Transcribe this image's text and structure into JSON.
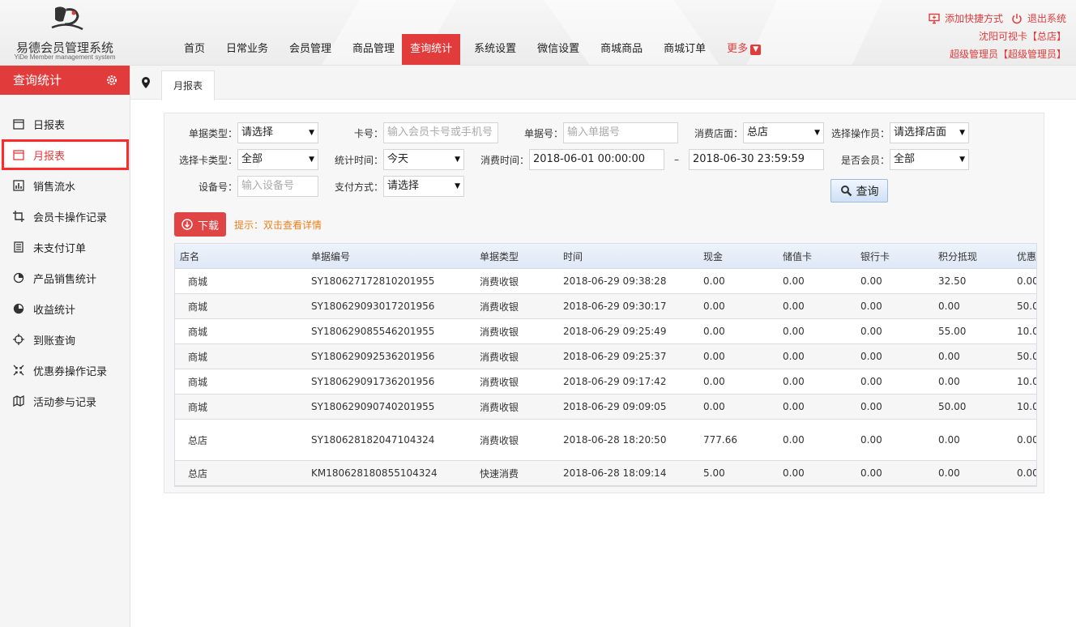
{
  "brand": {
    "title": "易德会员管理系统",
    "subtitle": "YiDe Member management system"
  },
  "nav": [
    "首页",
    "日常业务",
    "会员管理",
    "商品管理",
    "查询统计",
    "系统设置",
    "微信设置",
    "商城商品",
    "商城订单"
  ],
  "nav_more": "更多",
  "topright": {
    "add_shortcut": "添加快捷方式",
    "logout": "退出系统",
    "card_line": "沈阳可视卡【总店】",
    "admin_line": "超级管理员【超级管理员】"
  },
  "sidebar": {
    "title": "查询统计",
    "items": [
      "日报表",
      "月报表",
      "销售流水",
      "会员卡操作记录",
      "未支付订单",
      "产品销售统计",
      "收益统计",
      "到账查询",
      "优惠券操作记录",
      "活动参与记录"
    ]
  },
  "tab": {
    "label": "月报表"
  },
  "filters": {
    "bill_type_label": "单据类型：",
    "bill_type_value": "请选择",
    "card_label": "卡号：",
    "card_placeholder": "输入会员卡号或手机号",
    "bill_no_label": "单据号：",
    "bill_no_placeholder": "输入单据号",
    "store_label": "消费店面：",
    "store_value": "总店",
    "operator_label": "选择操作员：",
    "operator_value": "请选择店面",
    "card_type_label": "选择卡类型：",
    "card_type_value": "全部",
    "stat_time_label": "统计时间：",
    "stat_time_value": "今天",
    "consume_time_label": "消费时间：",
    "time_start": "2018-06-01 00:00:00",
    "time_sep": "–",
    "time_end": "2018-06-30 23:59:59",
    "is_member_label": "是否会员：",
    "is_member_value": "全部",
    "device_label": "设备号：",
    "device_placeholder": "输入设备号",
    "pay_label": "支付方式：",
    "pay_value": "请选择",
    "query_button": "查询"
  },
  "download_button": "下载",
  "hint": "提示：双击查看详情",
  "table": {
    "headers": [
      "店名",
      "单据编号",
      "单据类型",
      "时间",
      "现金",
      "储值卡",
      "银行卡",
      "积分抵现",
      "优惠"
    ],
    "rows": [
      [
        "商城",
        "SY180627172810201955",
        "消费收银",
        "2018-06-29 09:38:28",
        "0.00",
        "0.00",
        "0.00",
        "32.50",
        "0.00"
      ],
      [
        "商城",
        "SY180629093017201956",
        "消费收银",
        "2018-06-29 09:30:17",
        "0.00",
        "0.00",
        "0.00",
        "0.00",
        "50.0"
      ],
      [
        "商城",
        "SY180629085546201955",
        "消费收银",
        "2018-06-29 09:25:49",
        "0.00",
        "0.00",
        "0.00",
        "55.00",
        "10.0"
      ],
      [
        "商城",
        "SY180629092536201956",
        "消费收银",
        "2018-06-29 09:25:37",
        "0.00",
        "0.00",
        "0.00",
        "0.00",
        "50.0"
      ],
      [
        "商城",
        "SY180629091736201956",
        "消费收银",
        "2018-06-29 09:17:42",
        "0.00",
        "0.00",
        "0.00",
        "0.00",
        "10.0"
      ],
      [
        "商城",
        "SY180629090740201955",
        "消费收银",
        "2018-06-29 09:09:05",
        "0.00",
        "0.00",
        "0.00",
        "50.00",
        "10.0"
      ],
      [
        "总店",
        "SY180628182047104324",
        "消费收银",
        "2018-06-28 18:20:50",
        "777.66",
        "0.00",
        "0.00",
        "0.00",
        "0.00"
      ],
      [
        "总店",
        "KM180628180855104324",
        "快速消费",
        "2018-06-28 18:09:14",
        "5.00",
        "0.00",
        "0.00",
        "0.00",
        "0.00"
      ]
    ]
  },
  "colors": {
    "accent": "#e23b3b",
    "hint": "#e8801e"
  }
}
